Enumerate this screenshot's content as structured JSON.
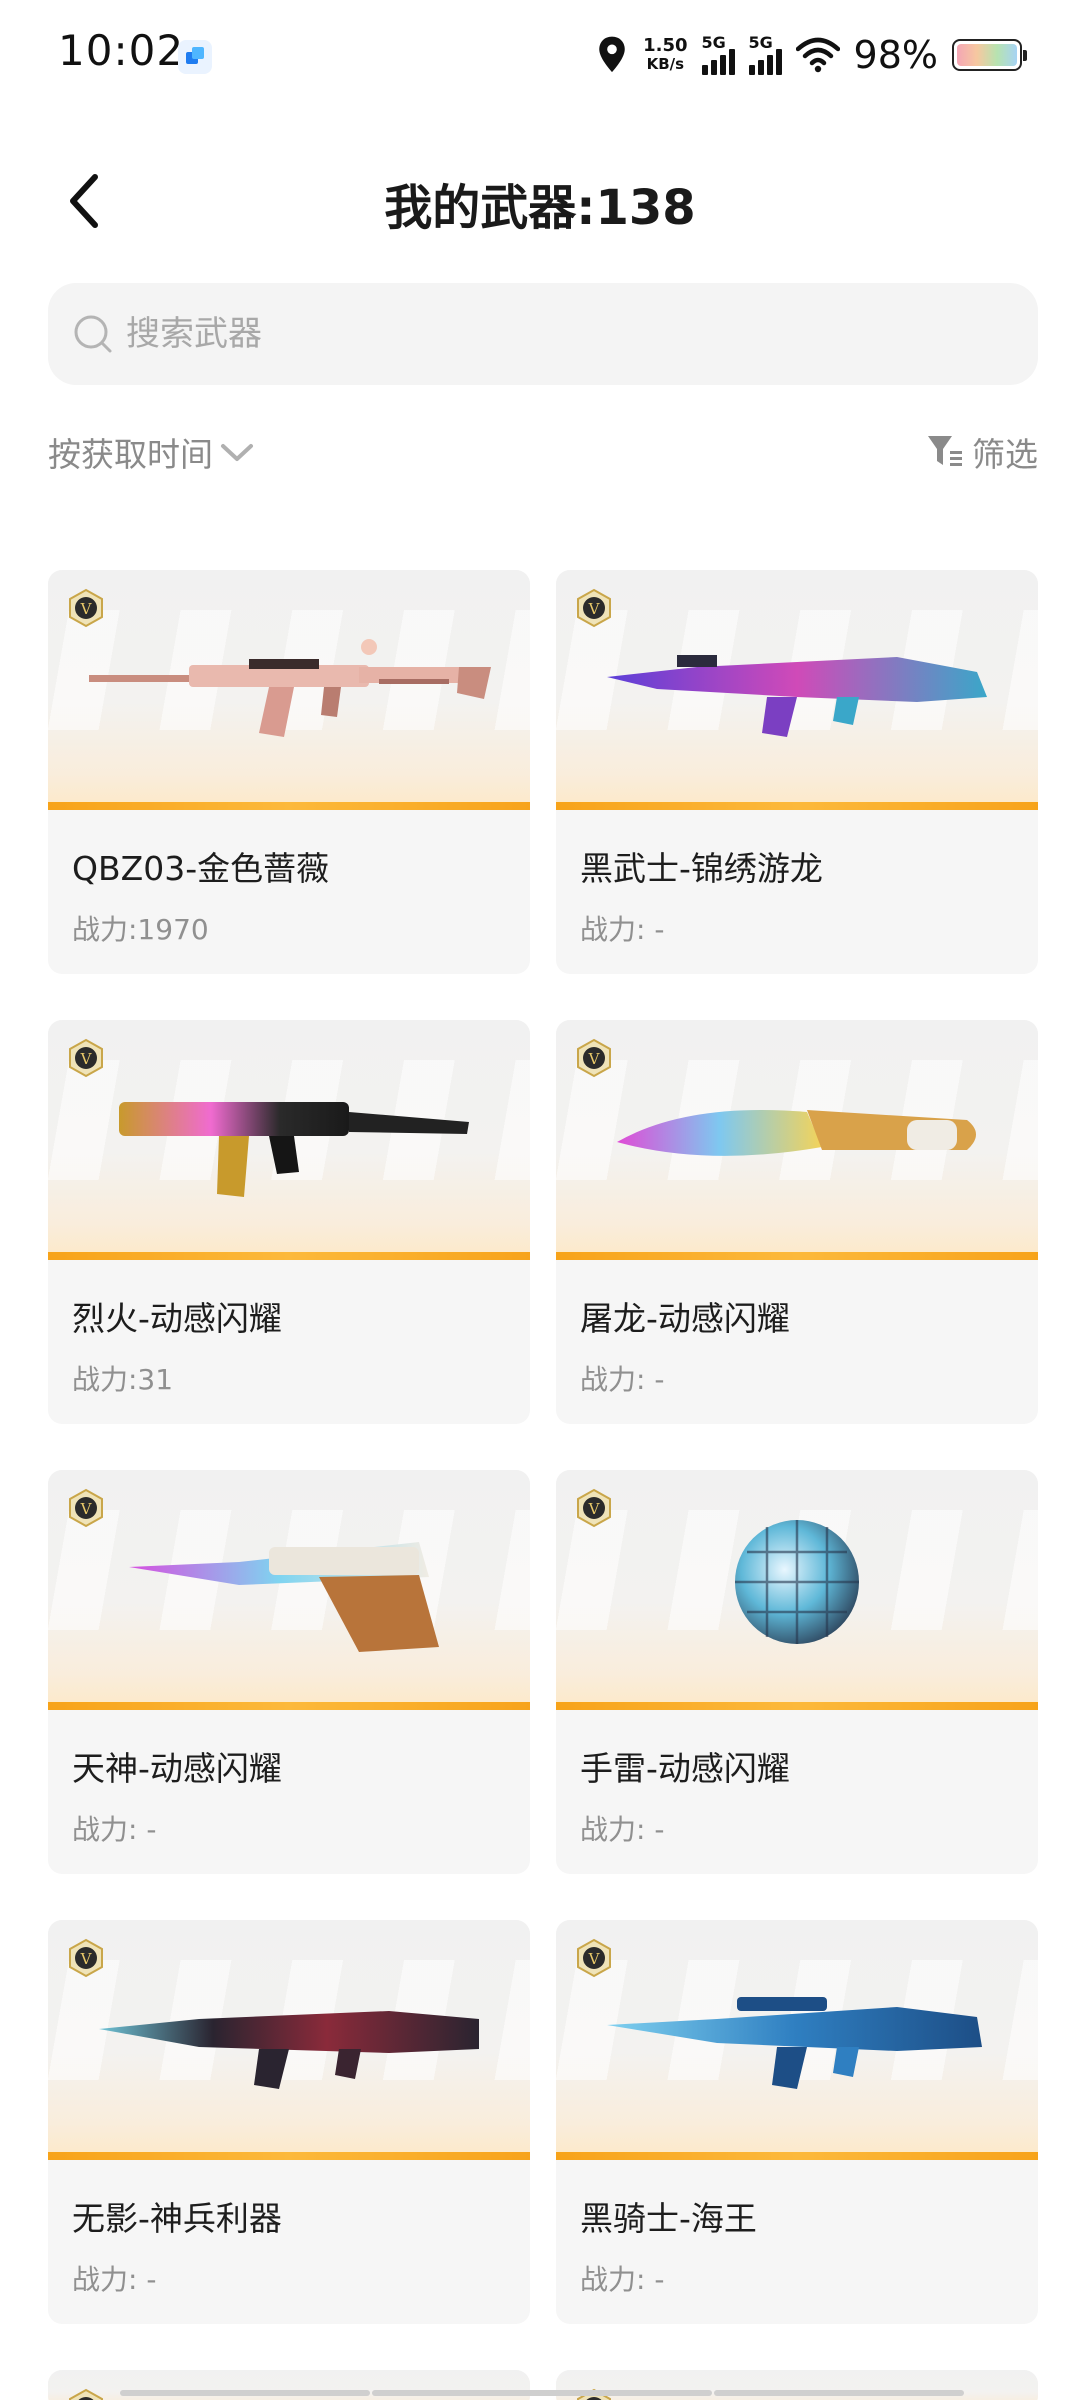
{
  "status_bar": {
    "time": "10:02",
    "net_speed_value": "1.50",
    "net_speed_unit": "KB/s",
    "signal1_label": "5G",
    "signal2_label": "5G",
    "battery": "98%"
  },
  "header": {
    "title": "我的武器:138"
  },
  "search": {
    "placeholder": "搜索武器"
  },
  "toolbar": {
    "sort_label": "按获取时间",
    "filter_label": "筛选"
  },
  "colors": {
    "rarity_gold": "#f7a31a",
    "card_bg": "#f6f6f6",
    "muted_text": "#909090"
  },
  "weapons": [
    {
      "name": "QBZ03-金色蔷薇",
      "power": "战力:1970",
      "icon": "rifle-icon"
    },
    {
      "name": "黑武士-锦绣游龙",
      "power": "战力: -",
      "icon": "rifle-icon"
    },
    {
      "name": "烈火-动感闪耀",
      "power": "战力:31",
      "icon": "smg-icon"
    },
    {
      "name": "屠龙-动感闪耀",
      "power": "战力: -",
      "icon": "knife-icon"
    },
    {
      "name": "天神-动感闪耀",
      "power": "战力: -",
      "icon": "pistol-icon"
    },
    {
      "name": "手雷-动感闪耀",
      "power": "战力: -",
      "icon": "grenade-icon"
    },
    {
      "name": "无影-神兵利器",
      "power": "战力: -",
      "icon": "rifle-icon"
    },
    {
      "name": "黑骑士-海王",
      "power": "战力: -",
      "icon": "rifle-icon"
    }
  ]
}
